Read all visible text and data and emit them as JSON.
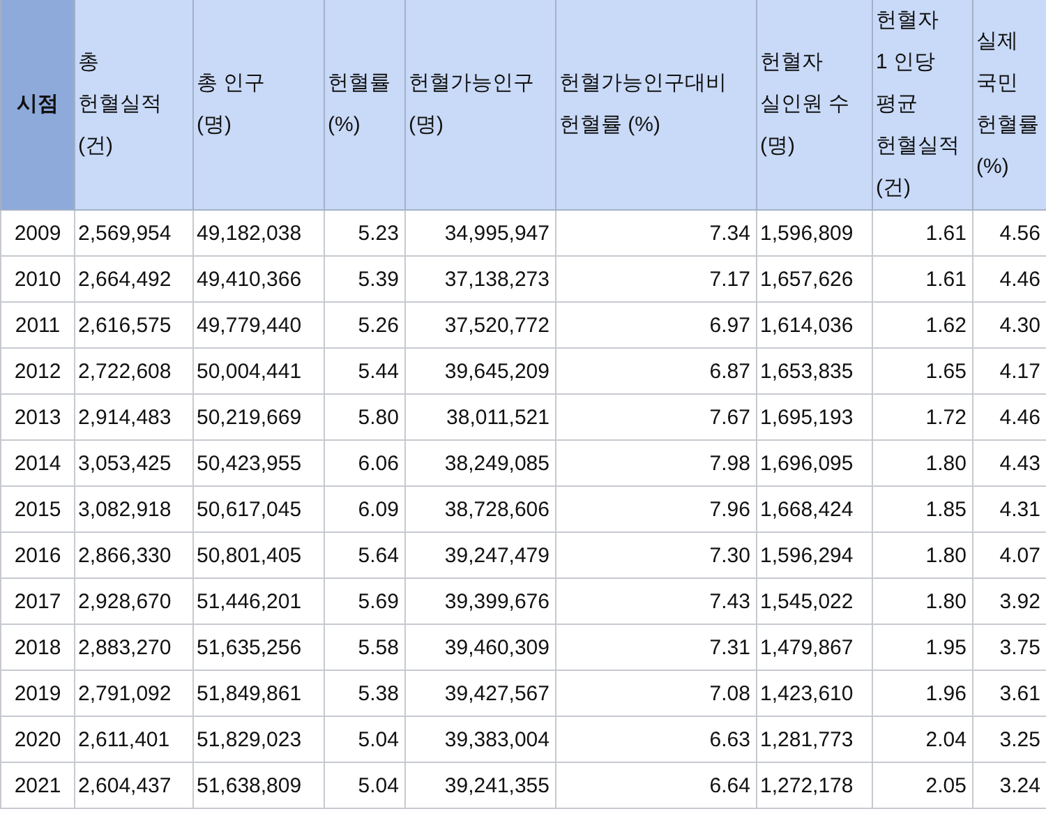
{
  "table": {
    "columns": [
      {
        "label": "시점"
      },
      {
        "label": "총\n헌혈실적\n(건)"
      },
      {
        "label": "총 인구\n(명)"
      },
      {
        "label": "헌혈률\n(%)"
      },
      {
        "label": "헌혈가능인구\n(명)"
      },
      {
        "label": "헌혈가능인구대비\n헌혈률 (%)"
      },
      {
        "label": "헌혈자\n실인원 수\n(명)"
      },
      {
        "label": "헌혈자\n1 인당\n평균\n헌혈실적\n(건)"
      },
      {
        "label": "실제\n국민\n헌혈률\n(%)"
      }
    ],
    "rows": [
      [
        "2009",
        "2,569,954",
        "49,182,038",
        "5.23",
        "34,995,947",
        "7.34",
        "1,596,809",
        "1.61",
        "4.56"
      ],
      [
        "2010",
        "2,664,492",
        "49,410,366",
        "5.39",
        "37,138,273",
        "7.17",
        "1,657,626",
        "1.61",
        "4.46"
      ],
      [
        "2011",
        "2,616,575",
        "49,779,440",
        "5.26",
        "37,520,772",
        "6.97",
        "1,614,036",
        "1.62",
        "4.30"
      ],
      [
        "2012",
        "2,722,608",
        "50,004,441",
        "5.44",
        "39,645,209",
        "6.87",
        "1,653,835",
        "1.65",
        "4.17"
      ],
      [
        "2013",
        "2,914,483",
        "50,219,669",
        "5.80",
        "38,011,521",
        "7.67",
        "1,695,193",
        "1.72",
        "4.46"
      ],
      [
        "2014",
        "3,053,425",
        "50,423,955",
        "6.06",
        "38,249,085",
        "7.98",
        "1,696,095",
        "1.80",
        "4.43"
      ],
      [
        "2015",
        "3,082,918",
        "50,617,045",
        "6.09",
        "38,728,606",
        "7.96",
        "1,668,424",
        "1.85",
        "4.31"
      ],
      [
        "2016",
        "2,866,330",
        "50,801,405",
        "5.64",
        "39,247,479",
        "7.30",
        "1,596,294",
        "1.80",
        "4.07"
      ],
      [
        "2017",
        "2,928,670",
        "51,446,201",
        "5.69",
        "39,399,676",
        "7.43",
        "1,545,022",
        "1.80",
        "3.92"
      ],
      [
        "2018",
        "2,883,270",
        "51,635,256",
        "5.58",
        "39,460,309",
        "7.31",
        "1,479,867",
        "1.95",
        "3.75"
      ],
      [
        "2019",
        "2,791,092",
        "51,849,861",
        "5.38",
        "39,427,567",
        "7.08",
        "1,423,610",
        "1.96",
        "3.61"
      ],
      [
        "2020",
        "2,611,401",
        "51,829,023",
        "5.04",
        "39,383,004",
        "6.63",
        "1,281,773",
        "2.04",
        "3.25"
      ],
      [
        "2021",
        "2,604,437",
        "51,638,809",
        "5.04",
        "39,241,355",
        "6.64",
        "1,272,178",
        "2.05",
        "3.24"
      ]
    ]
  }
}
